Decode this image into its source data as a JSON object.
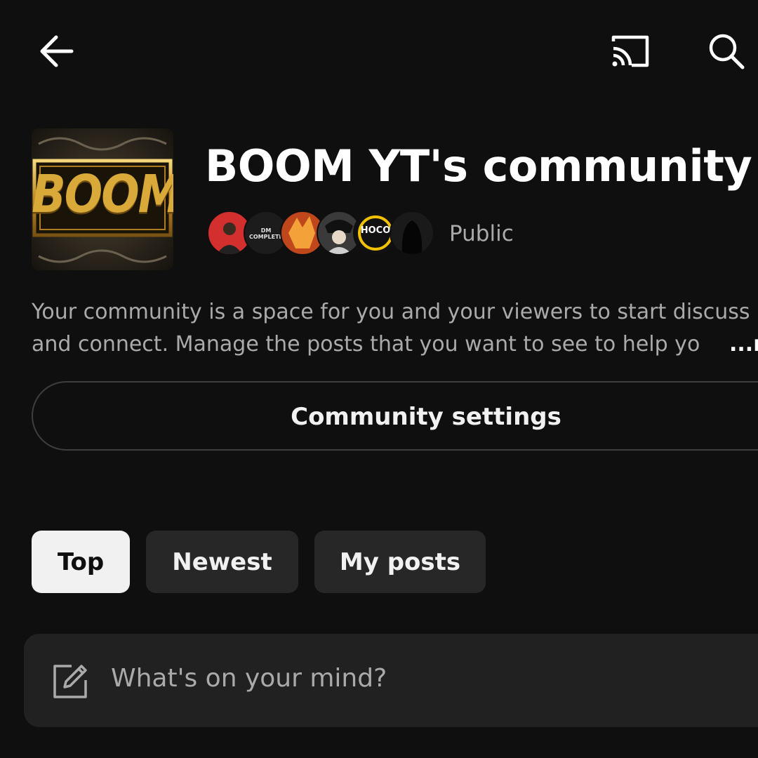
{
  "header": {
    "back_icon": "arrow-left-icon",
    "cast_icon": "cast-icon",
    "search_icon": "search-icon"
  },
  "community": {
    "logo_icon": "boom-logo",
    "logo_text": "BOOM",
    "title": "BOOM YT's community",
    "privacy": "Public",
    "member_avatars": [
      {
        "name": "avatar-member-1",
        "color": "#d32f2f"
      },
      {
        "name": "avatar-member-2",
        "color": "#1c1c1c",
        "label": "DM COMPLETE"
      },
      {
        "name": "avatar-member-3",
        "color": "#c0471b"
      },
      {
        "name": "avatar-member-4",
        "color": "#3a3a3a"
      },
      {
        "name": "avatar-member-5",
        "color": "#111111",
        "label": "HOCO"
      },
      {
        "name": "avatar-member-6",
        "color": "#1a1a1a"
      }
    ],
    "description_line1": "Your community is a space for you and your viewers to start discuss",
    "description_line2": "and connect. Manage the posts that you want to see to help yo",
    "more_label": "...m",
    "settings_label": "Community settings"
  },
  "filters": {
    "tabs": [
      {
        "label": "Top",
        "active": true
      },
      {
        "label": "Newest",
        "active": false
      },
      {
        "label": "My posts",
        "active": false
      }
    ]
  },
  "composer": {
    "icon": "edit-icon",
    "placeholder": "What's on your mind?"
  },
  "colors": {
    "background": "#0f0f0f",
    "chip": "#272727",
    "chip_active": "#f1f1f1",
    "composer_bg": "#212121",
    "secondary_text": "#aaaaaa",
    "logo_gold": "#d9a93a"
  }
}
